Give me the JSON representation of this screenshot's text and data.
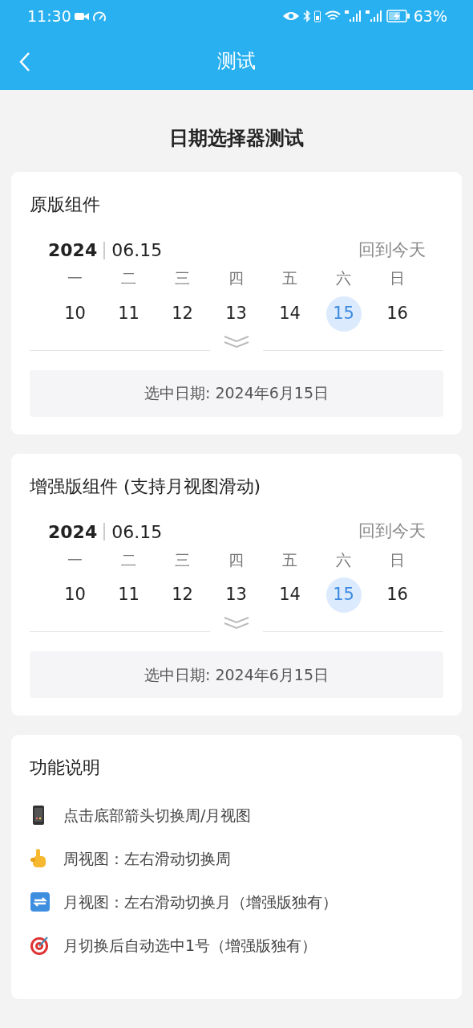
{
  "status_bar": {
    "time": "11:30",
    "battery": "63%"
  },
  "app_bar": {
    "title": "测试"
  },
  "page_title": "日期选择器测试",
  "pickers": [
    {
      "title": "原版组件",
      "year": "2024",
      "date": "06.15",
      "today_link": "回到今天",
      "weekdays": [
        "一",
        "二",
        "三",
        "四",
        "五",
        "六",
        "日"
      ],
      "days": [
        {
          "label": "10",
          "selected": false
        },
        {
          "label": "11",
          "selected": false
        },
        {
          "label": "12",
          "selected": false
        },
        {
          "label": "13",
          "selected": false
        },
        {
          "label": "14",
          "selected": false
        },
        {
          "label": "15",
          "selected": true
        },
        {
          "label": "16",
          "selected": false
        }
      ],
      "selected_text": "选中日期: 2024年6月15日"
    },
    {
      "title": "增强版组件 (支持月视图滑动)",
      "year": "2024",
      "date": "06.15",
      "today_link": "回到今天",
      "weekdays": [
        "一",
        "二",
        "三",
        "四",
        "五",
        "六",
        "日"
      ],
      "days": [
        {
          "label": "10",
          "selected": false
        },
        {
          "label": "11",
          "selected": false
        },
        {
          "label": "12",
          "selected": false
        },
        {
          "label": "13",
          "selected": false
        },
        {
          "label": "14",
          "selected": false
        },
        {
          "label": "15",
          "selected": true
        },
        {
          "label": "16",
          "selected": false
        }
      ],
      "selected_text": "选中日期: 2024年6月15日"
    }
  ],
  "features": {
    "title": "功能说明",
    "items": [
      {
        "kind": "phone",
        "text": "点击底部箭头切换周/月视图"
      },
      {
        "kind": "pointer",
        "text": "周视图：左右滑动切换周"
      },
      {
        "kind": "repeat",
        "text": "月视图：左右滑动切换月（增强版独有）"
      },
      {
        "kind": "target",
        "text": "月切换后自动选中1号（增强版独有）"
      }
    ]
  }
}
